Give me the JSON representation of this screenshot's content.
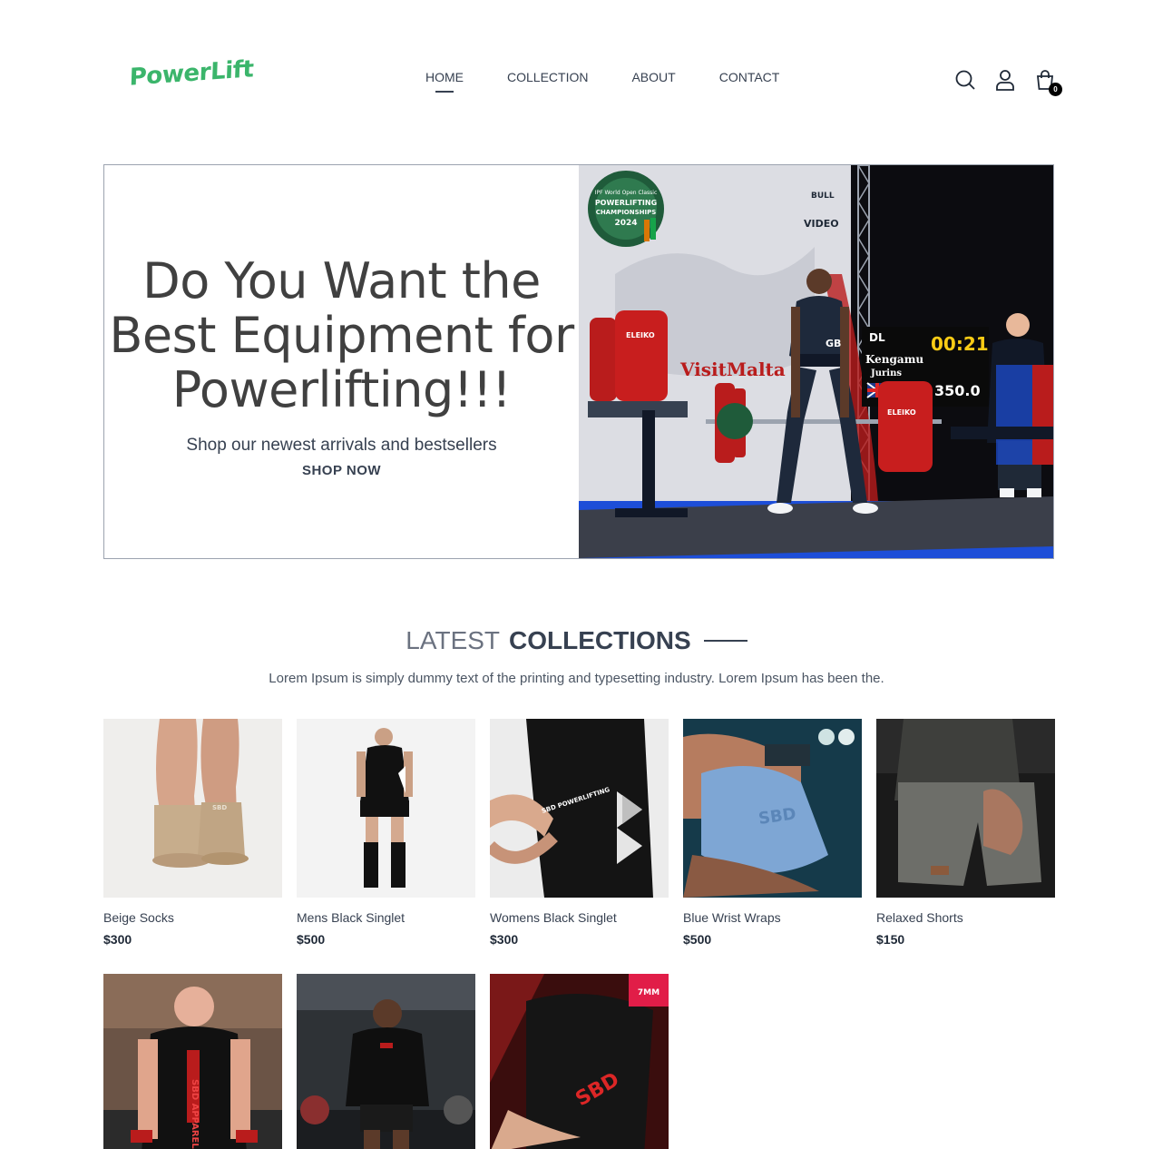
{
  "brand": {
    "logo_text": "PowerLift",
    "accent": "#3bb56b"
  },
  "nav": {
    "items": [
      {
        "label": "HOME",
        "active": true
      },
      {
        "label": "COLLECTION",
        "active": false
      },
      {
        "label": "ABOUT",
        "active": false
      },
      {
        "label": "CONTACT",
        "active": false
      }
    ]
  },
  "header_icons": {
    "search": "search-icon",
    "account": "user-icon",
    "cart": "shopping-bag-icon",
    "cart_count": "0"
  },
  "hero": {
    "title": "Do You Want the Best Equipment for Powerlifting!!!",
    "subtitle": "Shop our newest arrivals and bestsellers",
    "cta": "SHOP NOW",
    "image_text": {
      "banner": "IPF World Open Classic POWERLIFTING CHAMPIONSHIPS 2024",
      "timer": "00:21",
      "lift": "DL",
      "lifter": "Kengamu Jurins",
      "country": "GBR",
      "weight": "350.0",
      "sponsor": "VisitMalta",
      "plate_brand": "ELEIKO"
    }
  },
  "collections": {
    "title_light": "LATEST",
    "title_bold": "COLLECTIONS",
    "description": "Lorem Ipsum is simply dummy text of the printing and typesetting industry. Lorem Ipsum has been the.",
    "products": [
      {
        "name": "Beige Socks",
        "price": "$300"
      },
      {
        "name": "Mens Black Singlet",
        "price": "$500"
      },
      {
        "name": "Womens Black Singlet",
        "price": "$300"
      },
      {
        "name": "Blue Wrist Wraps",
        "price": "$500"
      },
      {
        "name": "Relaxed Shorts",
        "price": "$150"
      },
      {
        "name": "",
        "price": ""
      },
      {
        "name": "",
        "price": ""
      },
      {
        "name": "",
        "price": "",
        "badge": "7MM"
      }
    ]
  }
}
